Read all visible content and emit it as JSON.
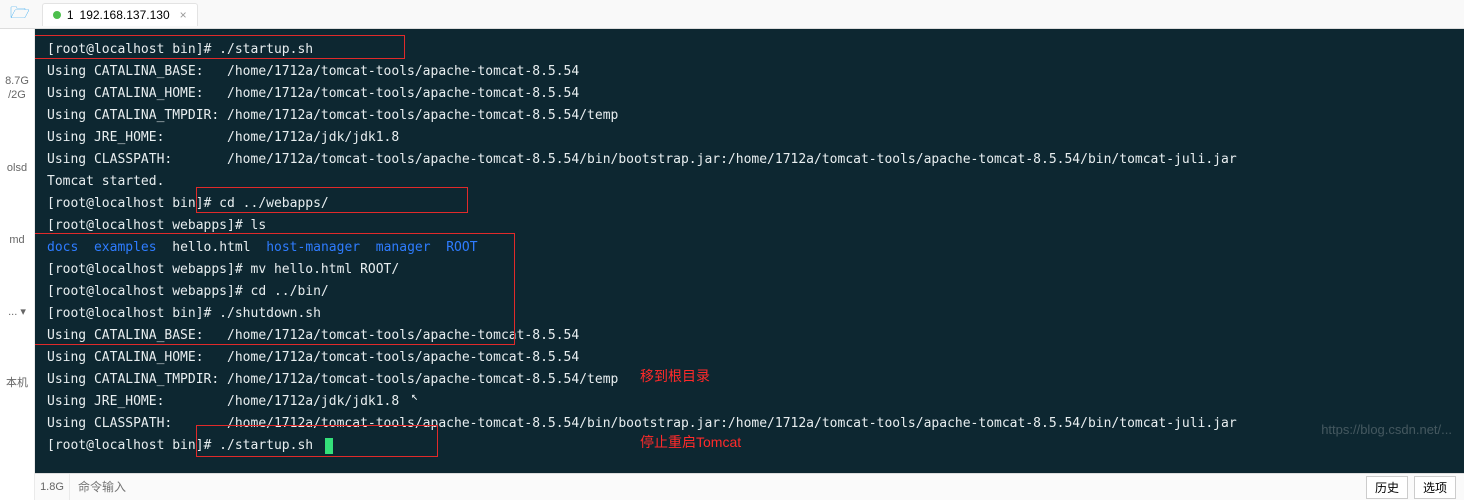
{
  "tab": {
    "index": "1",
    "title": "192.168.137.130",
    "close": "×"
  },
  "sidebar": {
    "disk1": "8.7G",
    "disk2": "/2G",
    "svc1": "olsd",
    "svc2": "md",
    "ellipsis": "...  ▾",
    "local": "本机",
    "bottom_stat": "1.8G"
  },
  "terminal": {
    "lines": [
      {
        "t": "[root@localhost bin]# ./startup.sh"
      },
      {
        "t": "Using CATALINA_BASE:   /home/1712a/tomcat-tools/apache-tomcat-8.5.54"
      },
      {
        "t": "Using CATALINA_HOME:   /home/1712a/tomcat-tools/apache-tomcat-8.5.54"
      },
      {
        "t": "Using CATALINA_TMPDIR: /home/1712a/tomcat-tools/apache-tomcat-8.5.54/temp"
      },
      {
        "t": "Using JRE_HOME:        /home/1712a/jdk/jdk1.8"
      },
      {
        "t": "Using CLASSPATH:       /home/1712a/tomcat-tools/apache-tomcat-8.5.54/bin/bootstrap.jar:/home/1712a/tomcat-tools/apache-tomcat-8.5.54/bin/tomcat-juli.jar"
      },
      {
        "t": "Tomcat started."
      },
      {
        "t": "[root@localhost bin]# cd ../webapps/"
      },
      {
        "t": "[root@localhost webapps]# ls"
      },
      {
        "type": "ls",
        "items": [
          {
            "text": "docs",
            "cls": "dir-blue"
          },
          {
            "text": "examples",
            "cls": "dir-blue"
          },
          {
            "text": "hello.html",
            "cls": ""
          },
          {
            "text": "host-manager",
            "cls": "dir-blue"
          },
          {
            "text": "manager",
            "cls": "dir-blue"
          },
          {
            "text": "ROOT",
            "cls": "dir-blue"
          }
        ]
      },
      {
        "t": "[root@localhost webapps]# mv hello.html ROOT/"
      },
      {
        "t": "[root@localhost webapps]# cd ../bin/"
      },
      {
        "t": "[root@localhost bin]# ./shutdown.sh"
      },
      {
        "t": "Using CATALINA_BASE:   /home/1712a/tomcat-tools/apache-tomcat-8.5.54"
      },
      {
        "t": "Using CATALINA_HOME:   /home/1712a/tomcat-tools/apache-tomcat-8.5.54"
      },
      {
        "t": "Using CATALINA_TMPDIR: /home/1712a/tomcat-tools/apache-tomcat-8.5.54/temp"
      },
      {
        "t": "Using JRE_HOME:        /home/1712a/jdk/jdk1.8"
      },
      {
        "t": "Using CLASSPATH:       /home/1712a/tomcat-tools/apache-tomcat-8.5.54/bin/bootstrap.jar:/home/1712a/tomcat-tools/apache-tomcat-8.5.54/bin/tomcat-juli.jar"
      },
      {
        "t": "[root@localhost bin]# ./startup.sh ",
        "cursor": true
      }
    ]
  },
  "annotations": {
    "line1": "移到根目录",
    "line2": "停止重启Tomcat"
  },
  "bottom": {
    "placeholder": "命令输入",
    "history_btn": "历史",
    "options_btn": "选项"
  },
  "watermark": "https://blog.csdn.net/..."
}
